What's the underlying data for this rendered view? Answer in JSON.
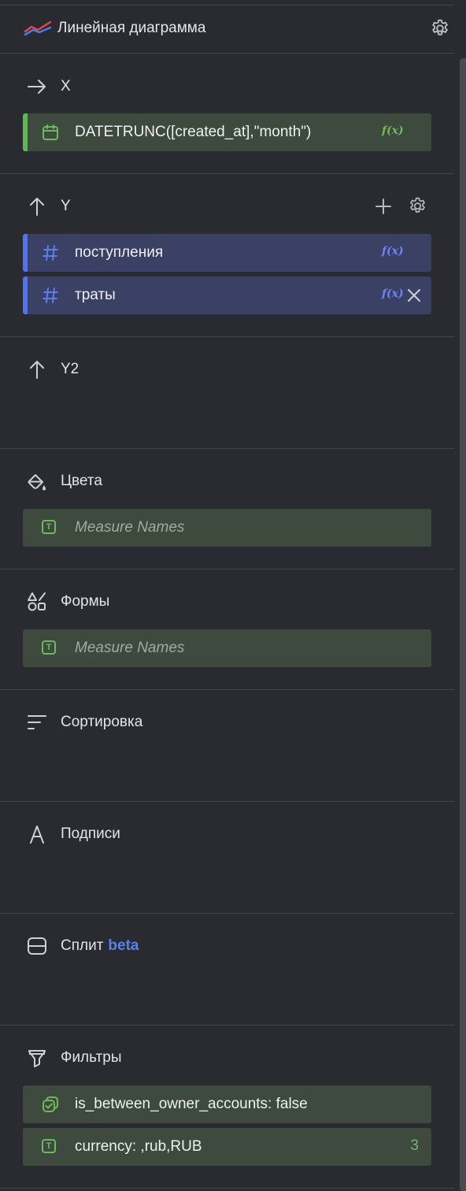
{
  "header": {
    "title": "Линейная диаграмма",
    "chart_icon": "line-chart-icon",
    "settings_icon": "gear-icon"
  },
  "sections": {
    "x": {
      "title": "X",
      "icon": "arrow-right-icon",
      "items": [
        {
          "label": "DATETRUNC([created_at],\"month\")",
          "icon": "calendar-icon",
          "fx": "f(x)"
        }
      ]
    },
    "y": {
      "title": "Y",
      "icon": "arrow-up-icon",
      "items": [
        {
          "label": "поступления",
          "icon": "hash-icon",
          "fx": "f(x)"
        },
        {
          "label": "траты",
          "icon": "hash-icon",
          "fx": "f(x)"
        }
      ]
    },
    "y2": {
      "title": "Y2",
      "icon": "arrow-up-icon"
    },
    "colors": {
      "title": "Цвета",
      "icon": "paint-bucket-icon",
      "items": [
        {
          "label": "Measure Names",
          "icon": "text-type-icon",
          "type_letter": "T"
        }
      ]
    },
    "shapes": {
      "title": "Формы",
      "icon": "shapes-icon",
      "items": [
        {
          "label": "Measure Names",
          "icon": "text-type-icon",
          "type_letter": "T"
        }
      ]
    },
    "sort": {
      "title": "Сортировка",
      "icon": "sort-icon"
    },
    "labels": {
      "title": "Подписи",
      "icon": "letter-a-icon"
    },
    "split": {
      "title": "Сплит",
      "badge": "beta",
      "icon": "split-icon"
    },
    "filters": {
      "title": "Фильтры",
      "icon": "filter-icon",
      "items": [
        {
          "label": "is_between_owner_accounts: false",
          "icon": "boolean-icon"
        },
        {
          "label": "currency: ,rub,RUB",
          "icon": "text-type-icon",
          "type_letter": "T",
          "count": "3"
        }
      ]
    }
  },
  "colors": {
    "background": "#2a2a31",
    "green_chip": "#3d4a3d",
    "blue_chip": "#3b4164",
    "green_accent": "#63b655",
    "blue_accent": "#5473e8",
    "beta": "#5b80e6"
  }
}
